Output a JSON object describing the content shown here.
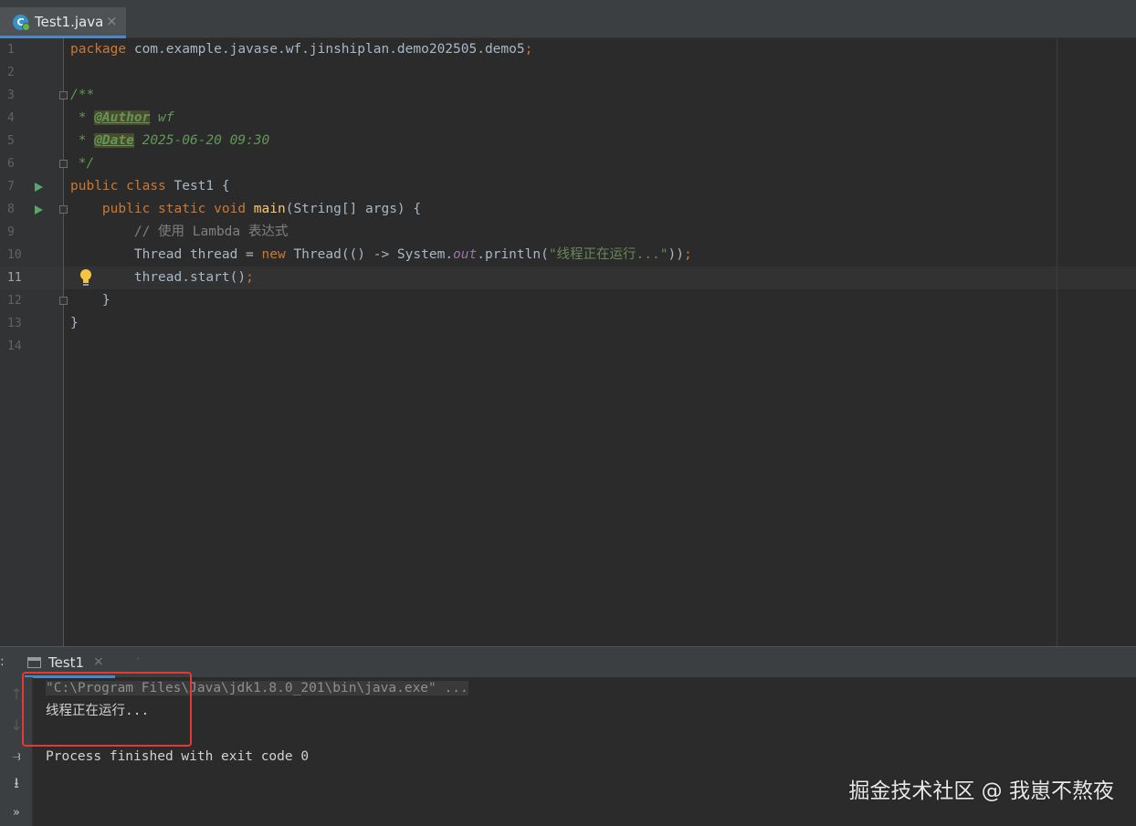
{
  "editor_tab": {
    "label": "Test1.java",
    "close": "×",
    "icon": "java-class-icon"
  },
  "line_numbers": [
    "1",
    "2",
    "3",
    "4",
    "5",
    "6",
    "7",
    "8",
    "9",
    "10",
    "11",
    "12",
    "13",
    "14"
  ],
  "code": {
    "l1": {
      "kw": "package",
      "rest": " com.example.javase.wf.jinshiplan.demo202505.demo5",
      "semi": ";"
    },
    "l3": "/**",
    "l4": {
      "star": " * ",
      "tag": "@Author",
      "val": " wf"
    },
    "l5": {
      "star": " * ",
      "tag": "@Date",
      "val": " 2025-06-20 09:30"
    },
    "l6": " */",
    "l7": {
      "kw": "public class",
      "rest": " Test1 {"
    },
    "l8": {
      "indent": "    ",
      "kw": "public static void",
      "sp": " ",
      "fn": "main",
      "rest": "(String[] args) {"
    },
    "l9": "        // 使用 Lambda 表达式",
    "l10": {
      "a": "        Thread thread = ",
      "kw": "new",
      "b": " Thread(() -> System.",
      "field": "out",
      "c": ".println(",
      "str": "\"线程正在运行...\"",
      "d": "))",
      "semi": ";"
    },
    "l11": {
      "a": "        thread.start()",
      "semi": ";"
    },
    "l12": "    }",
    "l13": "}"
  },
  "run_panel": {
    "colon": ":",
    "tab_label": "Test1",
    "tab_close": "×",
    "console": [
      "\"C:\\Program Files\\Java\\jdk1.8.0_201\\bin\\java.exe\" ...",
      "线程正在运行...",
      "",
      "Process finished with exit code 0"
    ],
    "toolbar": [
      "up-arrow-icon",
      "down-arrow-icon",
      "soft-wrap-icon",
      "scroll-to-end-icon",
      "more-icon"
    ]
  },
  "watermark": "掘金技术社区 @ 我崽不熬夜",
  "colors": {
    "accent": "#4a88c7",
    "run": "#59a869",
    "highlight_box": "#e53935"
  }
}
